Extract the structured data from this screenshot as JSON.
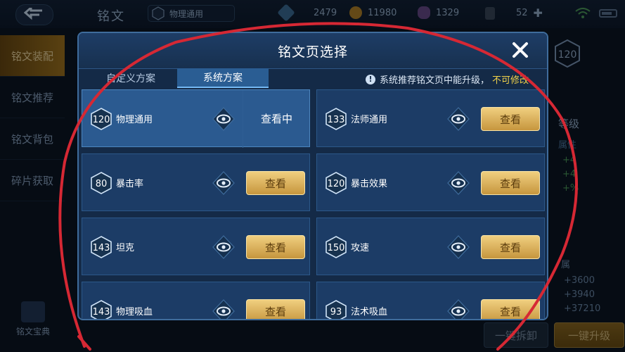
{
  "topbar": {
    "title": "铭文",
    "current_page_level": "120",
    "current_page_name": "物理通用",
    "resources": [
      {
        "icon": "diamond-icon",
        "value": "2479"
      },
      {
        "icon": "gold-coin-icon",
        "value": "11980"
      },
      {
        "icon": "crystal-icon",
        "value": "1329"
      },
      {
        "icon": "card-icon",
        "value": "52"
      }
    ]
  },
  "sidenav": {
    "items": [
      {
        "label": "铭文装配",
        "active": true
      },
      {
        "label": "铭文推荐",
        "active": false
      },
      {
        "label": "铭文背包",
        "active": false
      },
      {
        "label": "碎片获取",
        "active": false
      }
    ],
    "book_label": "铭文宝典"
  },
  "right_panel": {
    "level_hex": "120",
    "level_label": "等级",
    "sub_label": "属性",
    "green_values": [
      "+4",
      "+4",
      "+%"
    ],
    "attr_label": "属",
    "values": [
      "+3600",
      "+3940",
      "+37210"
    ],
    "unload_label": "一键拆卸",
    "upgrade_label": "一键升级"
  },
  "dialog": {
    "title": "铭文页选择",
    "tabs": [
      {
        "label": "自定义方案",
        "active": false
      },
      {
        "label": "系统方案",
        "active": true
      }
    ],
    "notice_text": "系统推荐铭文页中能升级，",
    "notice_warn": "不可修改",
    "view_label": "查看",
    "viewing_label": "查看中",
    "cards": [
      {
        "level": "120",
        "name": "物理通用",
        "state": "viewing"
      },
      {
        "level": "133",
        "name": "法师通用",
        "state": "view"
      },
      {
        "level": "80",
        "name": "暴击率",
        "state": "view"
      },
      {
        "level": "120",
        "name": "暴击效果",
        "state": "view"
      },
      {
        "level": "143",
        "name": "坦克",
        "state": "view"
      },
      {
        "level": "150",
        "name": "攻速",
        "state": "view"
      },
      {
        "level": "143",
        "name": "物理吸血",
        "state": "view"
      },
      {
        "level": "93",
        "name": "法术吸血",
        "state": "view"
      }
    ]
  },
  "colors": {
    "accent_gold": "#e6bd63",
    "dialog_bg": "#142a47",
    "selected_card": "#2b5a90",
    "annotation_red": "#d62834",
    "warning_yellow": "#f1d24a"
  }
}
